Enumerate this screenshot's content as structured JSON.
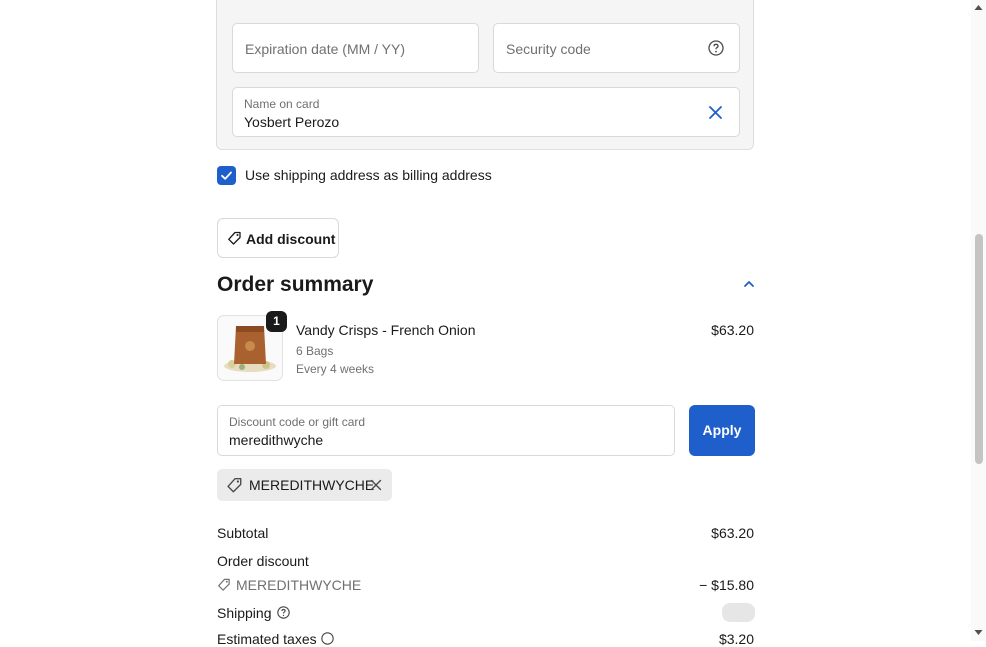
{
  "payment": {
    "expiration_placeholder": "Expiration date (MM / YY)",
    "security_placeholder": "Security code",
    "name_label": "Name on card",
    "name_value": "Yosbert Perozo"
  },
  "billing": {
    "use_shipping_label": "Use shipping address as billing address",
    "use_shipping_checked": true
  },
  "discount_button_label": "Add discount",
  "order_summary": {
    "title": "Order summary",
    "item": {
      "quantity": "1",
      "name": "Vandy Crisps - French Onion",
      "variant": "6 Bags",
      "frequency": "Every 4 weeks",
      "price": "$63.20"
    },
    "discount_input": {
      "label": "Discount code or gift card",
      "value": "meredithwyche"
    },
    "apply_label": "Apply",
    "applied_code": "MEREDITHWYCHE",
    "subtotal_label": "Subtotal",
    "subtotal_value": "$63.20",
    "order_discount_label": "Order discount",
    "order_discount_code": "MEREDITHWYCHE",
    "order_discount_value": "− $15.80",
    "shipping_label": "Shipping",
    "taxes_label": "Estimated taxes",
    "taxes_value": "$3.20"
  },
  "colors": {
    "accent": "#1f5fcb"
  }
}
